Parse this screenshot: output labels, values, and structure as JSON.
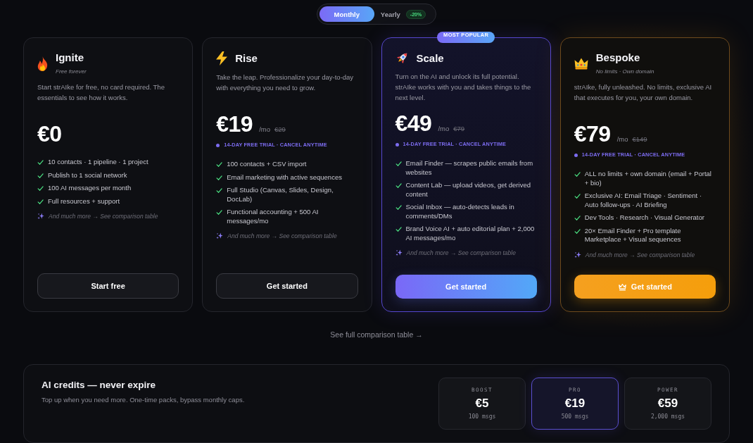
{
  "billing_toggle": {
    "options": [
      {
        "label": "Monthly",
        "selected": true
      },
      {
        "label": "Yearly",
        "selected": false,
        "badge": "-20%"
      }
    ]
  },
  "plans": [
    {
      "kind": "standard",
      "name": "Ignite",
      "tagline": "Free forever",
      "description": "Start strAIke for free, no card required. The essentials to see how it works.",
      "price": "€0",
      "features": [
        "10 contacts · 1 pipeline · 1 project",
        "Publish to 1 social network",
        "100 AI messages per month",
        "Full resources + support"
      ],
      "more": "And much more → See comparison table",
      "button": "Start free"
    },
    {
      "kind": "standard",
      "name": "Rise",
      "description": "Take the leap. Professionalize your day-to-day with everything you need to grow.",
      "price": "€19",
      "period": "/mo",
      "old_price": "€29",
      "trial": "14-DAY FREE TRIAL · CANCEL ANYTIME",
      "features": [
        "100 contacts + CSV import",
        "Email marketing with active sequences",
        "Full Studio (Canvas, Slides, Design, DocLab)",
        "Functional accounting + 500 AI messages/mo"
      ],
      "more": "And much more → See comparison table",
      "button": "Get started"
    },
    {
      "kind": "popular",
      "badge": "MOST POPULAR",
      "name": "Scale",
      "description": "Turn on the AI and unlock its full potential. strAIke works with you and takes things to the next level.",
      "price": "€49",
      "period": "/mo",
      "old_price": "€79",
      "trial": "14-DAY FREE TRIAL · CANCEL ANYTIME",
      "features": [
        "Email Finder — scrapes public emails from websites",
        "Content Lab — upload videos, get derived content",
        "Social Inbox — auto-detects leads in comments/DMs",
        "Brand Voice AI + auto editorial plan + 2,000 AI messages/mo"
      ],
      "more": "And much more → See comparison table",
      "button": "Get started"
    },
    {
      "kind": "premium",
      "name": "Bespoke",
      "tagline": "No limits · Own domain",
      "description": "strAIke, fully unleashed. No limits, exclusive AI that executes for you, your own domain.",
      "price": "€79",
      "period": "/mo",
      "old_price": "€149",
      "trial": "14-DAY FREE TRIAL · CANCEL ANYTIME",
      "features": [
        "ALL no limits + own domain (email + Portal + bio)",
        "Exclusive AI: Email Triage · Sentiment · Auto follow-ups · AI Briefing",
        "Dev Tools · Research · Visual Generator",
        "20× Email Finder + Pro template Marketplace + Visual sequences"
      ],
      "more": "And much more → See comparison table",
      "button": "Get started"
    }
  ],
  "comparison_link": "See full comparison table →",
  "credits": {
    "title": "AI credits — never expire",
    "description": "Top up when you need more. One-time packs, bypass monthly caps.",
    "packs": [
      {
        "name": "BOOST",
        "price": "€5",
        "amount": "100 msgs",
        "selected": false
      },
      {
        "name": "PRO",
        "price": "€19",
        "amount": "500 msgs",
        "selected": true
      },
      {
        "name": "POWER",
        "price": "€59",
        "amount": "2,000 msgs",
        "selected": false
      }
    ]
  }
}
